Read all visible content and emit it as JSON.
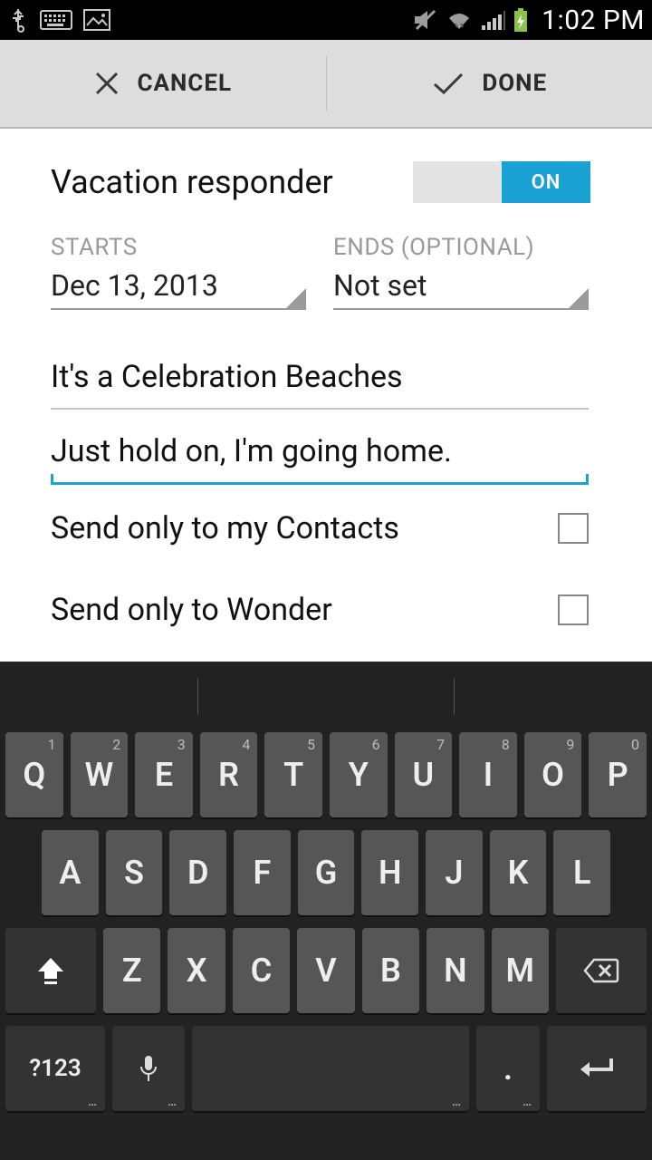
{
  "status": {
    "time": "1:02 PM"
  },
  "actions": {
    "cancel": "CANCEL",
    "done": "DONE"
  },
  "form": {
    "title": "Vacation responder",
    "toggle_state": "ON",
    "starts_label": "STARTS",
    "starts_value": "Dec 13, 2013",
    "ends_label": "ENDS (OPTIONAL)",
    "ends_value": "Not set",
    "subject": "It's a Celebration Beaches",
    "body": "Just hold on, I'm going home.",
    "check1": "Send only to my Contacts",
    "check2": "Send only to Wonder"
  },
  "keyboard": {
    "row1": [
      "Q",
      "W",
      "E",
      "R",
      "T",
      "Y",
      "U",
      "I",
      "O",
      "P"
    ],
    "row1_sup": [
      "1",
      "2",
      "3",
      "4",
      "5",
      "6",
      "7",
      "8",
      "9",
      "0"
    ],
    "row2": [
      "A",
      "S",
      "D",
      "F",
      "G",
      "H",
      "J",
      "K",
      "L"
    ],
    "row3": [
      "Z",
      "X",
      "C",
      "V",
      "B",
      "N",
      "M"
    ],
    "sym": "?123",
    "dot": "."
  }
}
